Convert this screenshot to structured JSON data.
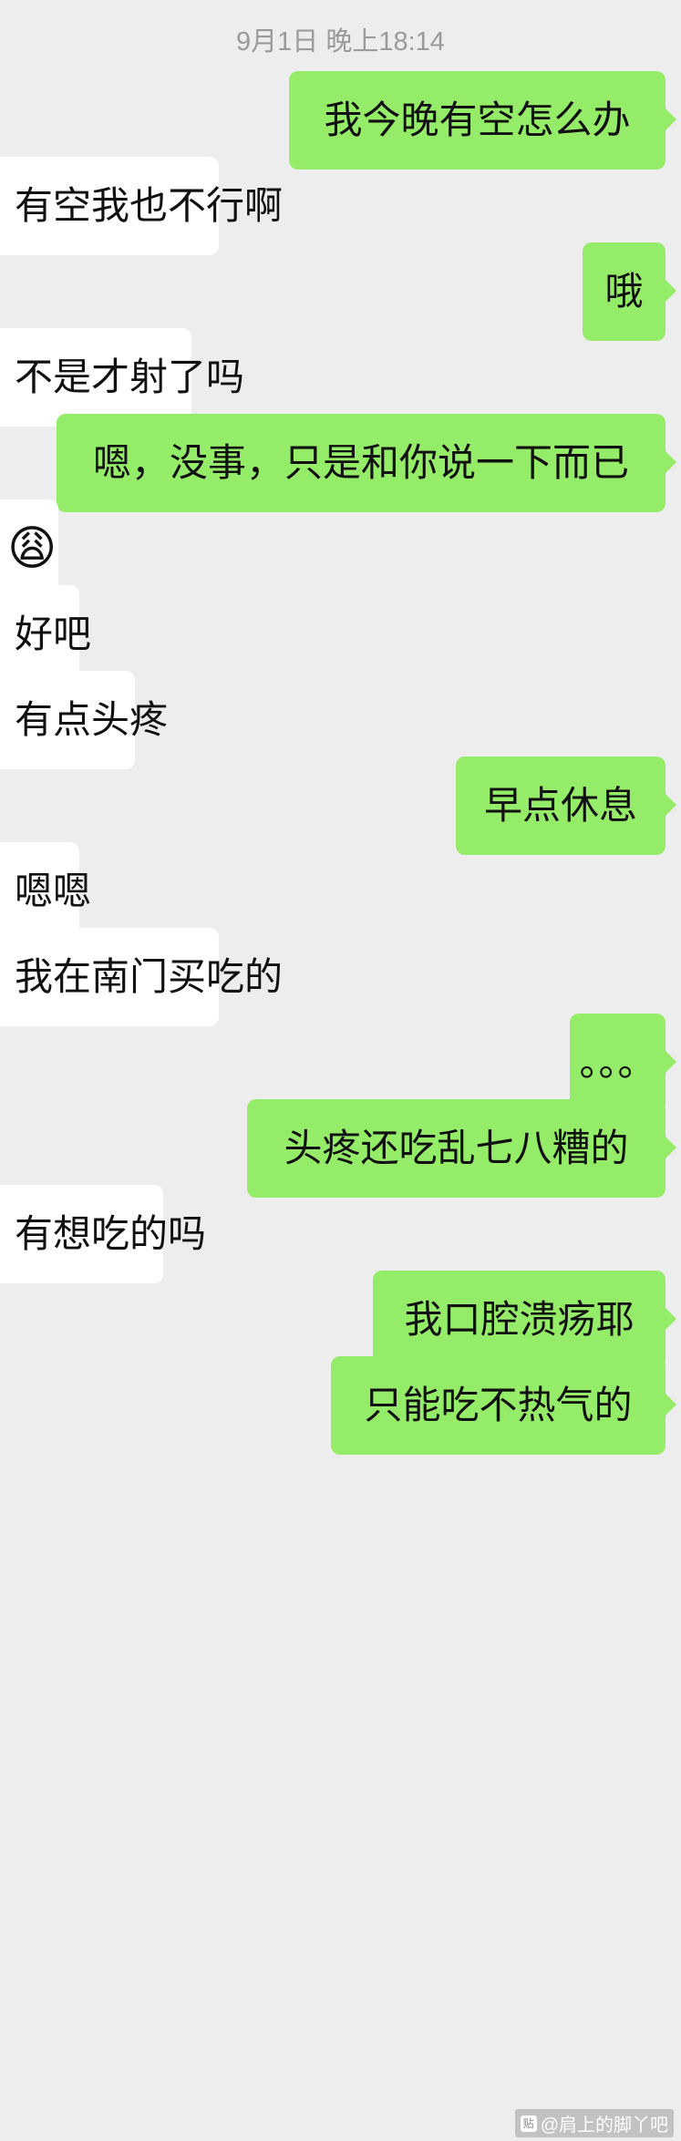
{
  "timestamp": "9月1日 晚上18:14",
  "messages": [
    {
      "side": "out",
      "text": "我今晚有空怎么办"
    },
    {
      "side": "in",
      "text": "有空我也不行啊"
    },
    {
      "side": "out",
      "text": "哦"
    },
    {
      "side": "in",
      "text": "不是才射了吗"
    },
    {
      "side": "out",
      "text": "嗯，没事，只是和你说一下而已"
    },
    {
      "side": "in",
      "text": "😩",
      "emoji": "face-palm-emoji"
    },
    {
      "side": "in",
      "text": "好吧"
    },
    {
      "side": "in",
      "text": "有点头疼"
    },
    {
      "side": "out",
      "text": "早点休息"
    },
    {
      "side": "in",
      "text": "嗯嗯"
    },
    {
      "side": "in",
      "text": "我在南门买吃的"
    },
    {
      "side": "out",
      "text": "。。。"
    },
    {
      "side": "out",
      "text": "头疼还吃乱七八糟的"
    },
    {
      "side": "in",
      "text": "有想吃的吗"
    },
    {
      "side": "out",
      "text": "我口腔溃疡耶"
    },
    {
      "side": "out",
      "text": "只能吃不热气的"
    }
  ],
  "watermark": "@肩上的脚丫吧",
  "colors": {
    "background": "#ededed",
    "outgoing_bubble": "#95ec69",
    "incoming_bubble": "#ffffff"
  }
}
